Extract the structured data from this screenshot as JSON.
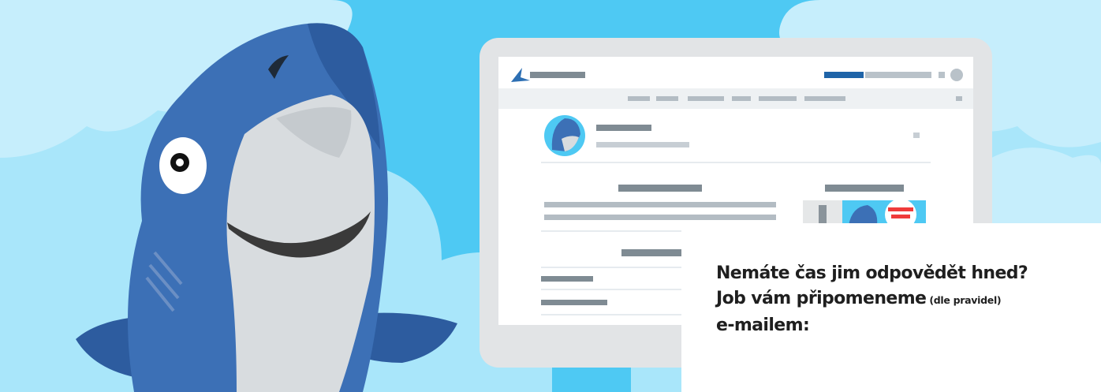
{
  "banner": {
    "colors": {
      "sky": "#4ec9f3",
      "cloud": "#a9e6fa",
      "cloud_light": "#c6eefc",
      "monitor_frame": "#e2e4e6",
      "monitor_screen": "#ffffff",
      "placeholder_text": "#7f8b93",
      "placeholder_light": "#c7ced4",
      "accent_blue": "#1f64a8",
      "accent_red": "#ef3b3b",
      "shark_blue": "#3c70b6",
      "shark_dark": "#2d5c9f",
      "shark_belly": "#d8dcdf"
    },
    "illustration": {
      "mascot": "shark-mascot",
      "device": "desktop-monitor-with-app-mockup"
    },
    "callout": {
      "line1": "Nemáte čas jim odpovědět hned?",
      "line2_main": "Job vám připomeneme",
      "line2_small": "(dle pravidel)",
      "line3": "e-mailem:"
    }
  }
}
